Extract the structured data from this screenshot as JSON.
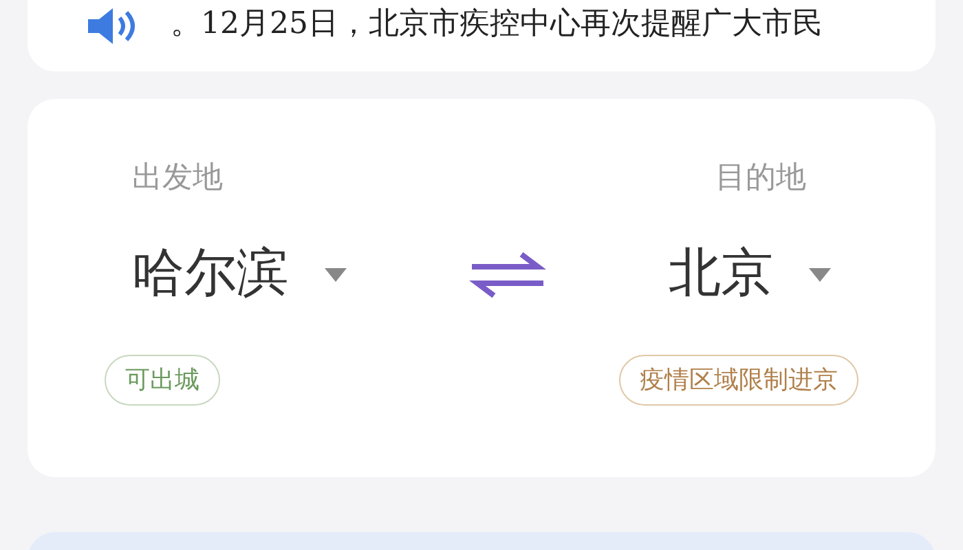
{
  "notice": {
    "text": "。12月25日，北京市疾控中心再次提醒广大市民"
  },
  "route": {
    "origin_label": "出发地",
    "destination_label": "目的地",
    "origin": "哈尔滨",
    "destination": "北京",
    "origin_status": "可出城",
    "destination_status": "疫情区域限制进京"
  }
}
